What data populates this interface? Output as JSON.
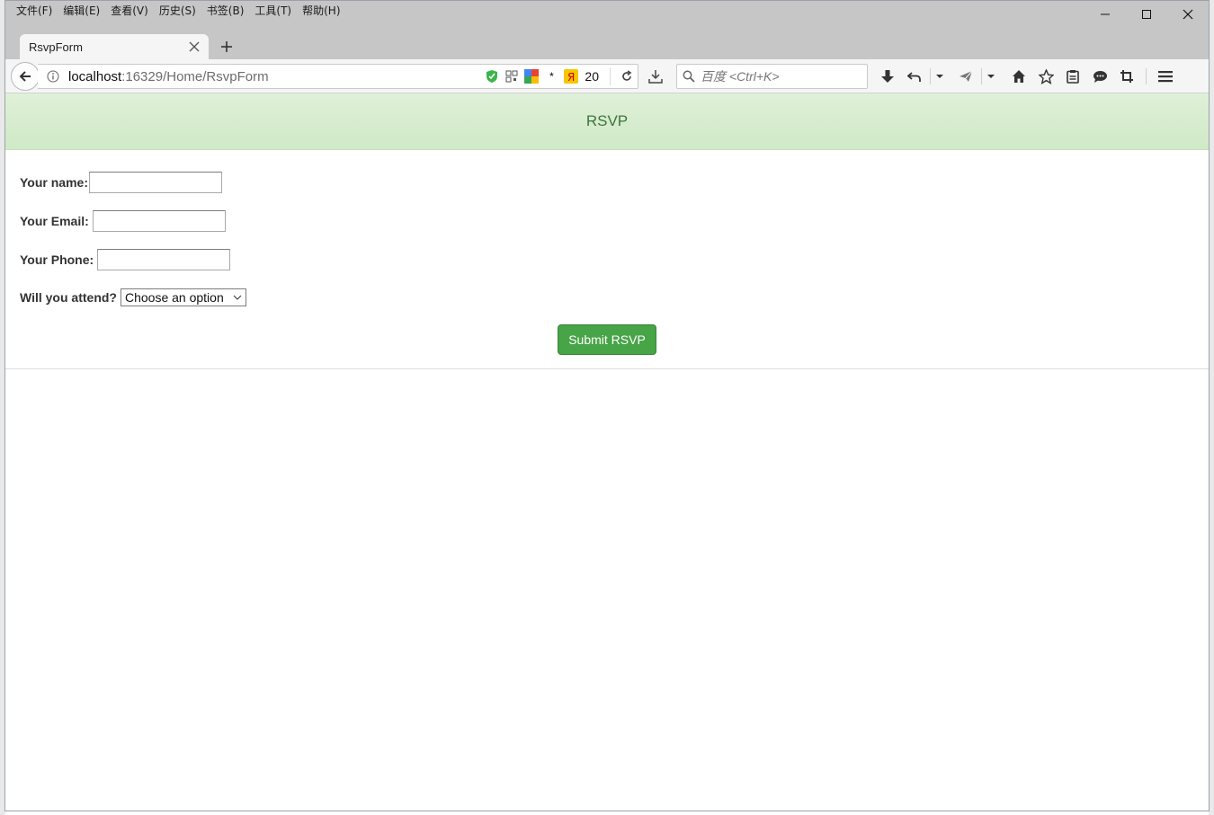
{
  "menubar": {
    "items": [
      "文件(F)",
      "编辑(E)",
      "查看(V)",
      "历史(S)",
      "书签(B)",
      "工具(T)",
      "帮助(H)"
    ]
  },
  "tab": {
    "title": "RsvpForm"
  },
  "urlbar": {
    "host": "localhost",
    "path": ":16329/Home/RsvpForm",
    "badge_count": "20",
    "asterisk": "*"
  },
  "search": {
    "placeholder": "百度 <Ctrl+K>"
  },
  "page": {
    "heading": "RSVP",
    "form": {
      "name_label": "Your name:",
      "email_label": "Your Email:",
      "phone_label": "Your Phone:",
      "attend_label": "Will you attend?",
      "attend_selected": "Choose an option",
      "submit_label": "Submit RSVP"
    }
  },
  "colors": {
    "heading_bg": "#dff0d8",
    "heading_text": "#3c763d",
    "submit_bg": "#47a447"
  }
}
